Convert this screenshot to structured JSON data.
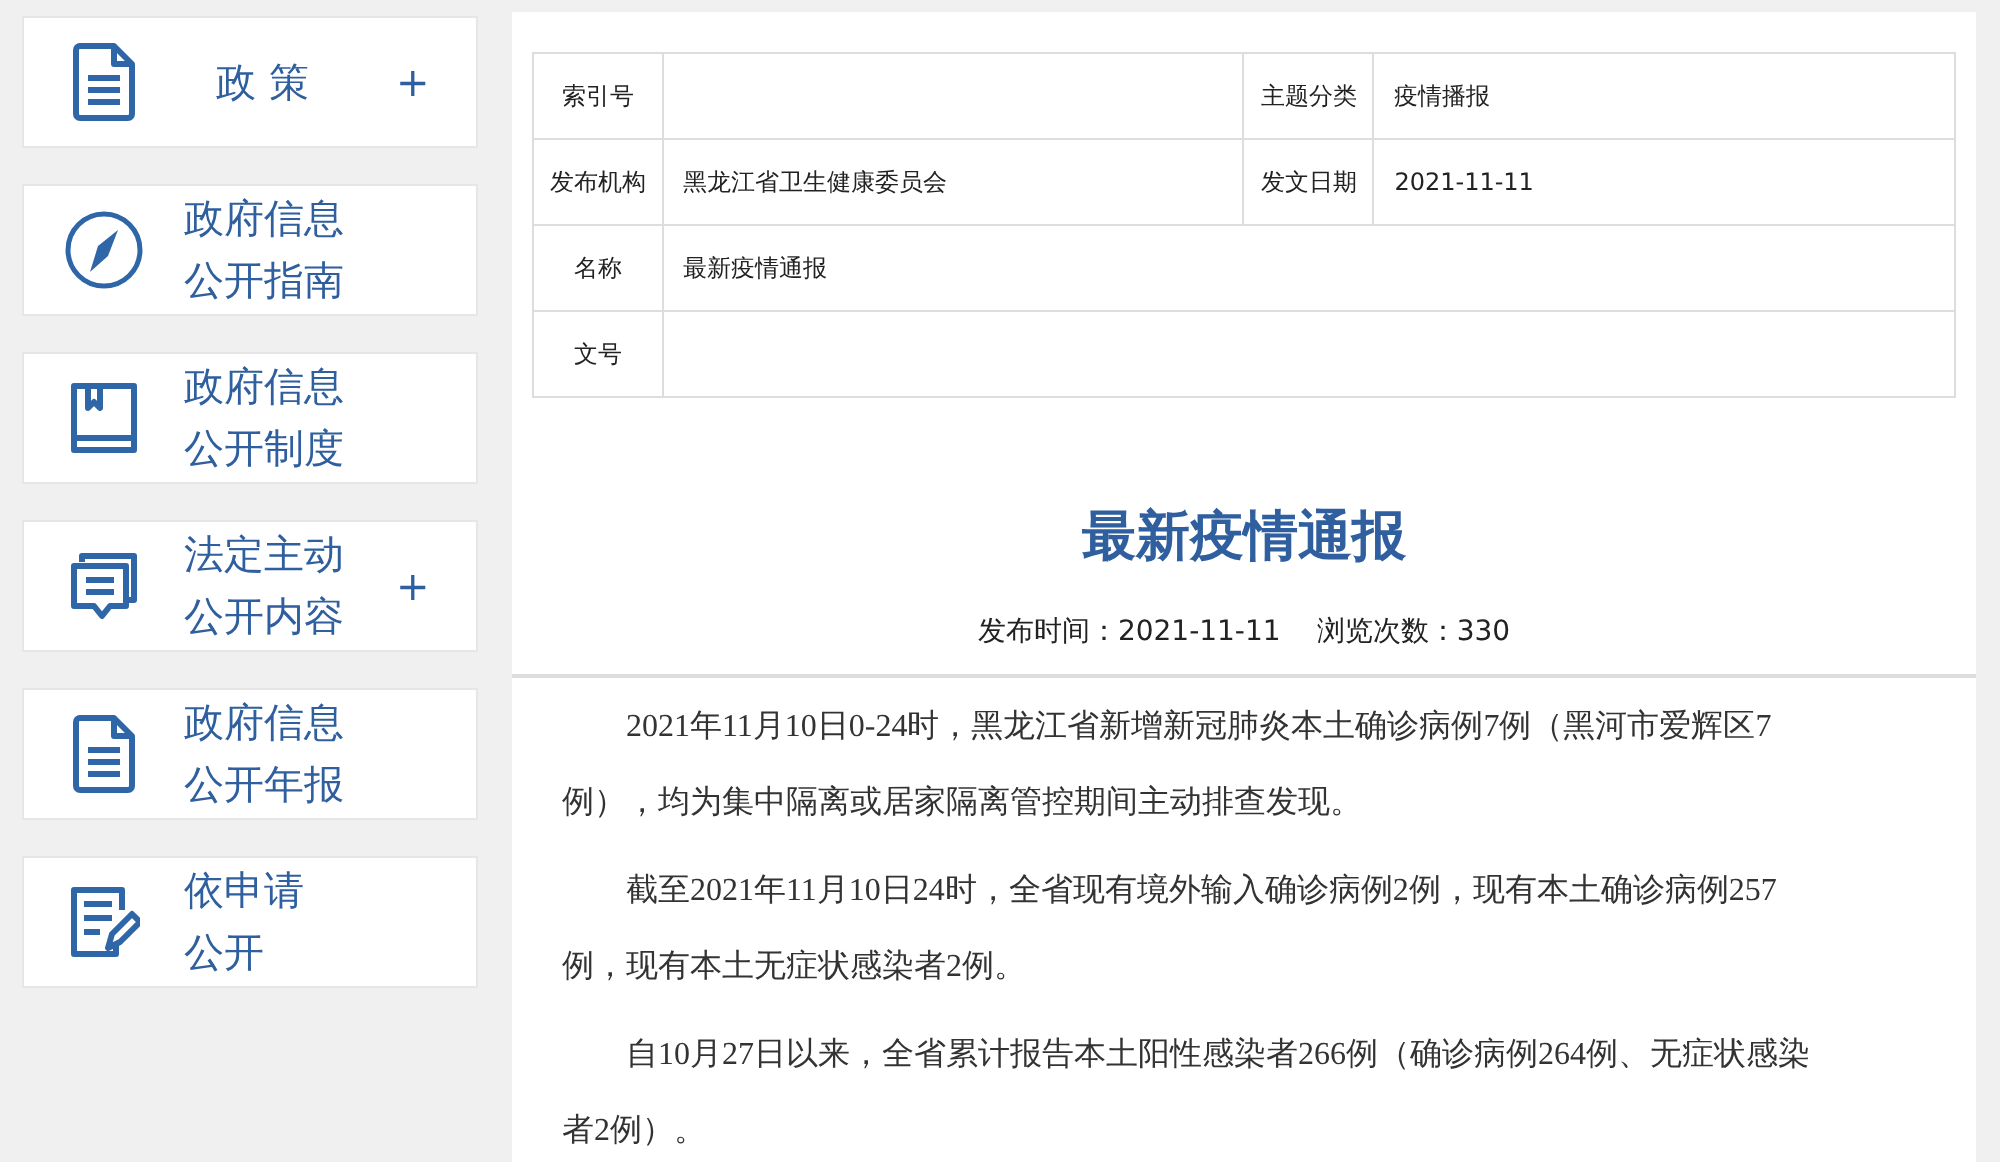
{
  "sidebar": {
    "items": [
      {
        "lines": [
          "政 策"
        ],
        "expandable": true
      },
      {
        "lines": [
          "政府信息",
          "公开指南"
        ],
        "expandable": false
      },
      {
        "lines": [
          "政府信息",
          "公开制度"
        ],
        "expandable": false
      },
      {
        "lines": [
          "法定主动",
          "公开内容"
        ],
        "expandable": true
      },
      {
        "lines": [
          "政府信息",
          "公开年报"
        ],
        "expandable": false
      },
      {
        "lines": [
          "依申请",
          "公开"
        ],
        "expandable": false
      }
    ],
    "expand_mark": "+"
  },
  "info_table": {
    "rows": [
      {
        "fields": [
          {
            "label": "索引号"
          },
          {
            "label": "主题分类",
            "value": "疫情播报"
          }
        ]
      },
      {
        "fields": [
          {
            "label": "发布机构",
            "value": "黑龙江省卫生健康委员会"
          },
          {
            "label": "发文日期",
            "value": "2021-11-11"
          }
        ]
      },
      {
        "fields": [
          {
            "label": "名称",
            "value": "最新疫情通报"
          }
        ]
      },
      {
        "fields": [
          {
            "label": "文号"
          }
        ]
      }
    ]
  },
  "article": {
    "title": "最新疫情通报",
    "publish_time": "发布时间：2021-11-11",
    "views": "浏览次数：330",
    "paragraphs": [
      "2021年11月10日0-24时，黑龙江省新增新冠肺炎本土确诊病例7例（黑河市爱辉区7例），均为集中隔离或居家隔离管控期间主动排查发现。",
      "截至2021年11月10日24时，全省现有境外输入确诊病例2例，现有本土确诊病例257例，现有本土无症状感染者2例。",
      "自10月27日以来，全省累计报告本土阳性感染者266例（确诊病例264例、无症状感染者2例）。"
    ]
  }
}
